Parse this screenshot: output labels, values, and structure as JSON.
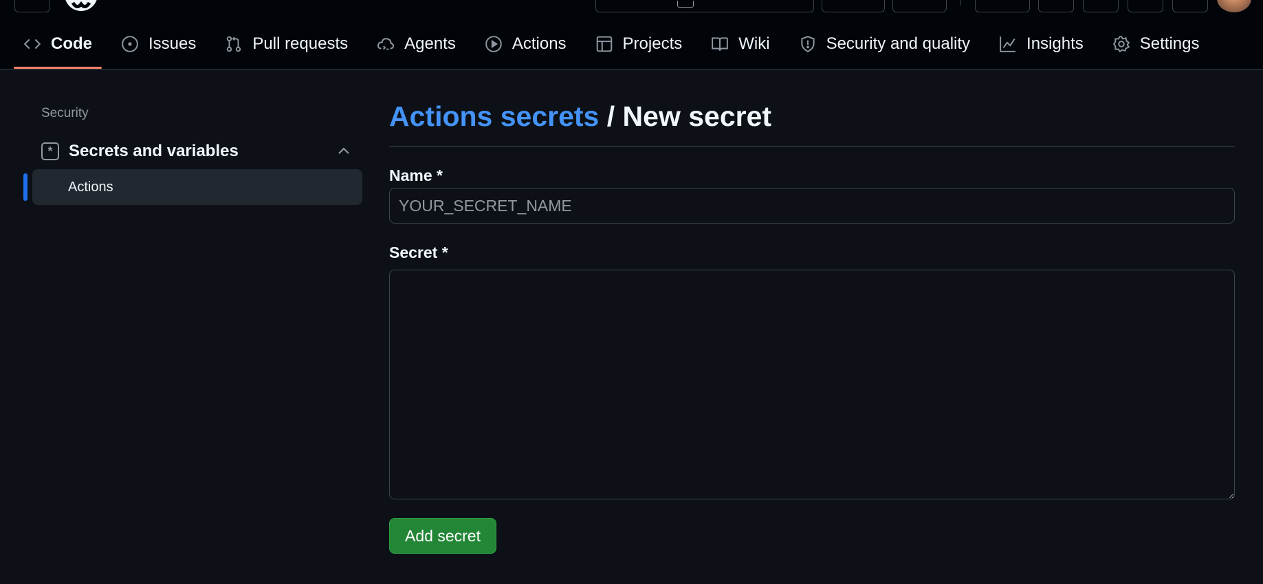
{
  "repo_nav": {
    "tabs": [
      {
        "label": "Code",
        "icon": "code-icon",
        "selected": true
      },
      {
        "label": "Issues",
        "icon": "issue-opened-icon"
      },
      {
        "label": "Pull requests",
        "icon": "git-pull-request-icon"
      },
      {
        "label": "Agents",
        "icon": "cloud-agent-icon"
      },
      {
        "label": "Actions",
        "icon": "play-icon"
      },
      {
        "label": "Projects",
        "icon": "table-icon"
      },
      {
        "label": "Wiki",
        "icon": "book-icon"
      },
      {
        "label": "Security and quality",
        "icon": "shield-icon"
      },
      {
        "label": "Insights",
        "icon": "graph-icon"
      },
      {
        "label": "Settings",
        "icon": "gear-icon"
      }
    ]
  },
  "sidebar": {
    "section_heading": "Security",
    "group": {
      "label": "Secrets and variables",
      "icon": "asterisk-icon",
      "expanded": true
    },
    "items": [
      {
        "label": "Actions",
        "selected": true
      }
    ]
  },
  "main": {
    "breadcrumb_link": "Actions secrets",
    "breadcrumb_separator": " / ",
    "title": "New secret",
    "name_label": "Name *",
    "name_placeholder": "YOUR_SECRET_NAME",
    "secret_label": "Secret *",
    "submit_label": "Add secret"
  },
  "colors": {
    "background": "#0d1117",
    "header": "#010409",
    "link": "#4493f8",
    "selected_tab_underline": "#f78166",
    "sidebar_marker": "#1f6feb",
    "primary_button": "#238636"
  }
}
